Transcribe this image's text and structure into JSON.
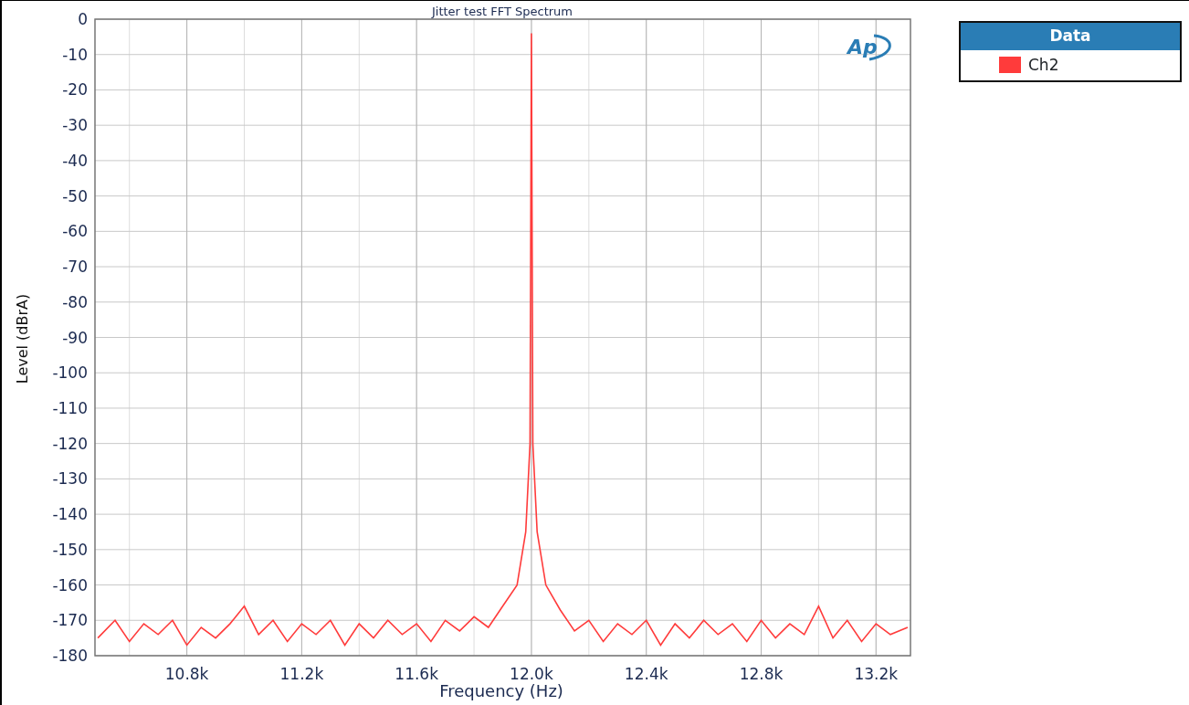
{
  "logo": "Ap",
  "chart_data": {
    "type": "line",
    "title": "Jitter test FFT Spectrum",
    "xlabel": "Frequency (Hz)",
    "ylabel": "Level (dBrA)",
    "x": [
      10490,
      10550,
      10600,
      10650,
      10700,
      10750,
      10800,
      10850,
      10900,
      10950,
      11000,
      11050,
      11100,
      11150,
      11200,
      11250,
      11300,
      11350,
      11400,
      11450,
      11500,
      11550,
      11600,
      11650,
      11700,
      11750,
      11800,
      11850,
      11900,
      11950,
      11980,
      11995,
      12000,
      12005,
      12020,
      12050,
      12100,
      12150,
      12200,
      12250,
      12300,
      12350,
      12400,
      12450,
      12500,
      12550,
      12600,
      12650,
      12700,
      12750,
      12800,
      12850,
      12900,
      12950,
      13000,
      13050,
      13100,
      13150,
      13200,
      13250,
      13310
    ],
    "series": [
      {
        "name": "Ch2",
        "color": "#ff3b3b",
        "values": [
          -175,
          -170,
          -176,
          -171,
          -174,
          -170,
          -177,
          -172,
          -175,
          -171,
          -166,
          -174,
          -170,
          -176,
          -171,
          -174,
          -170,
          -177,
          -171,
          -175,
          -170,
          -174,
          -171,
          -176,
          -170,
          -173,
          -169,
          -172,
          -166,
          -160,
          -145,
          -120,
          -4,
          -120,
          -145,
          -160,
          -167,
          -173,
          -170,
          -176,
          -171,
          -174,
          -170,
          -177,
          -171,
          -175,
          -170,
          -174,
          -171,
          -176,
          -170,
          -175,
          -171,
          -174,
          -166,
          -175,
          -170,
          -176,
          -171,
          -174,
          -172
        ]
      }
    ],
    "xlim": [
      10480,
      13320
    ],
    "ylim": [
      -180,
      0
    ],
    "xticks": [
      {
        "value": 10800,
        "label": "10.8k"
      },
      {
        "value": 11200,
        "label": "11.2k"
      },
      {
        "value": 11600,
        "label": "11.6k"
      },
      {
        "value": 12000,
        "label": "12.0k"
      },
      {
        "value": 12400,
        "label": "12.4k"
      },
      {
        "value": 12800,
        "label": "12.8k"
      },
      {
        "value": 13200,
        "label": "13.2k"
      }
    ],
    "yticks": [
      0,
      -10,
      -20,
      -30,
      -40,
      -50,
      -60,
      -70,
      -80,
      -90,
      -100,
      -110,
      -120,
      -130,
      -140,
      -150,
      -160,
      -170,
      -180
    ],
    "grid": true
  },
  "legend": {
    "title": "Data"
  }
}
